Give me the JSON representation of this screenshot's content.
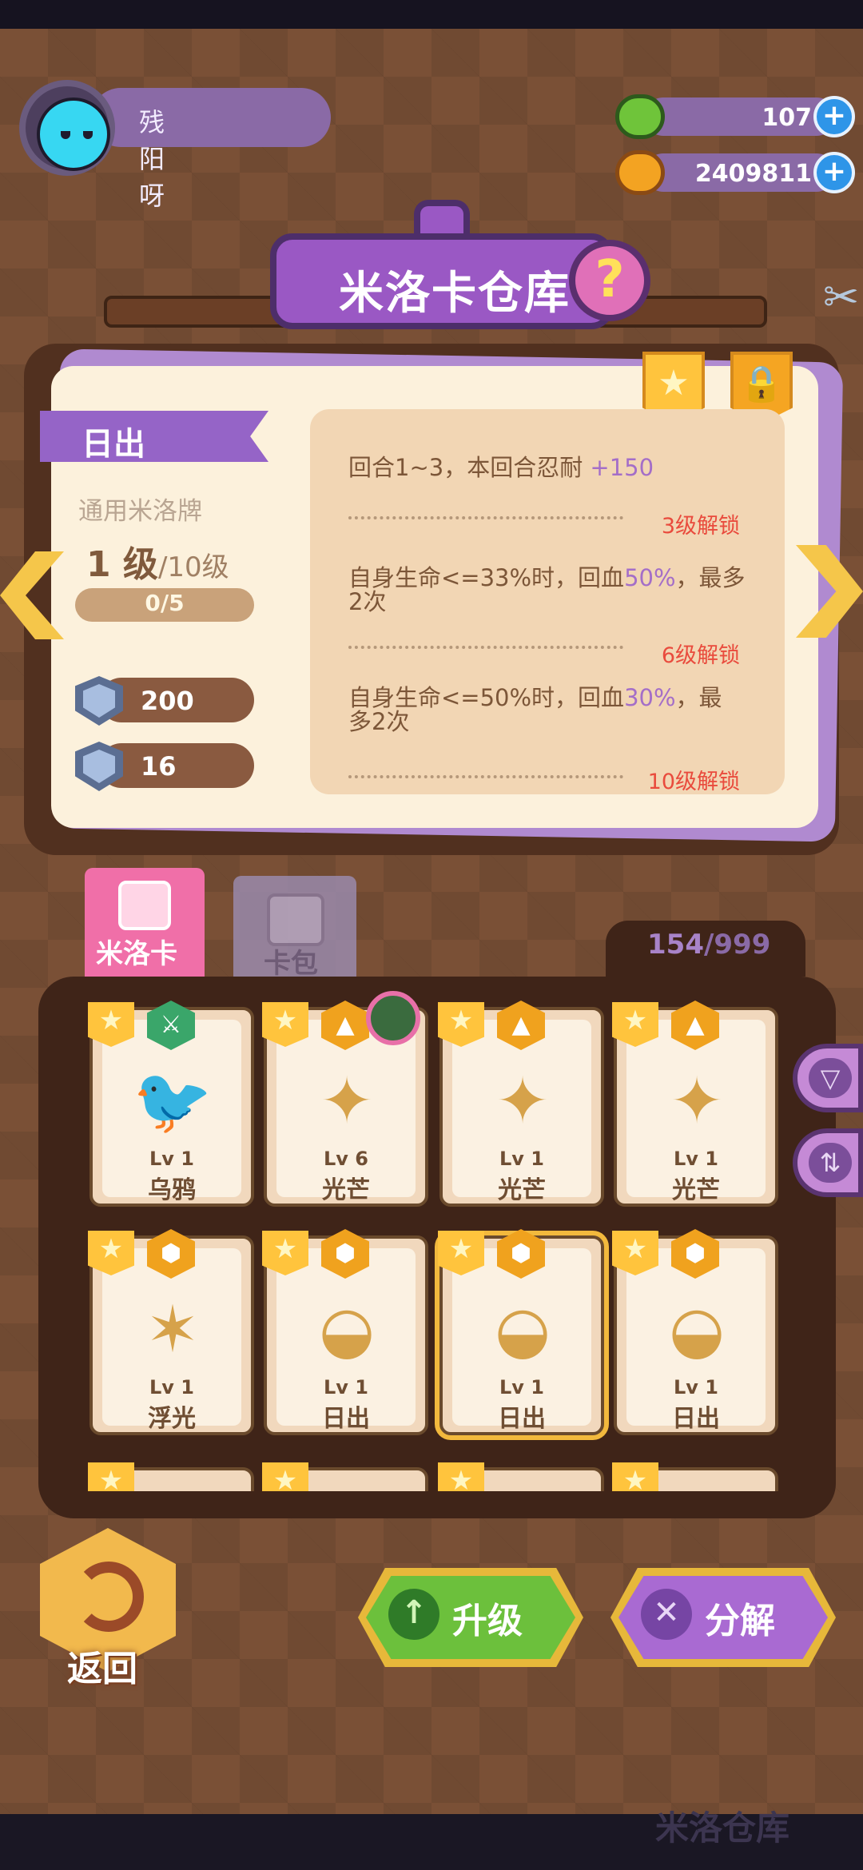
{
  "header": {
    "username": "残阳呀",
    "currencies": [
      {
        "icon": "green-gem-icon",
        "value": "107"
      },
      {
        "icon": "gold-planet-coin-icon",
        "value": "2409811"
      }
    ]
  },
  "title": "米洛卡仓库",
  "help_symbol": "?",
  "detail": {
    "name": "日出",
    "type": "通用米洛牌",
    "level_current": "1 级",
    "level_max": "/10级",
    "exp": "0/5",
    "exp_fraction": 0,
    "hp": "200",
    "defense": "16",
    "skills": [
      {
        "pre": "回合1~3，本回合忍耐 ",
        "hl": "+150",
        "post": "",
        "unlock": "3级解锁"
      },
      {
        "pre": "自身生命<=33%时，回血",
        "hl": "50%",
        "post": "，最多2次",
        "unlock": "6级解锁"
      },
      {
        "pre": "自身生命<=50%时，回血",
        "hl": "30%",
        "post": "，最多2次",
        "unlock": "10级解锁"
      }
    ]
  },
  "tabs": [
    {
      "label": "米洛卡",
      "active": true
    },
    {
      "label": "卡包",
      "active": false
    }
  ],
  "inventory": {
    "count": "154",
    "capacity": "/999"
  },
  "cards": [
    {
      "lv": "Lv 1",
      "name": "乌鸦",
      "badge": "green-sword-icon",
      "art": "crow-icon"
    },
    {
      "lv": "Lv 6",
      "name": "光芒",
      "badge": "up-triangle-icon",
      "art": "star-burst-icon"
    },
    {
      "lv": "Lv 1",
      "name": "光芒",
      "badge": "up-triangle-icon",
      "art": "star-burst-icon"
    },
    {
      "lv": "Lv 1",
      "name": "光芒",
      "badge": "up-triangle-icon",
      "art": "star-burst-icon"
    },
    {
      "lv": "Lv 1",
      "name": "浮光",
      "badge": "shield-badge-icon",
      "art": "floating-star-icon"
    },
    {
      "lv": "Lv 1",
      "name": "日出",
      "badge": "shield-badge-icon",
      "art": "sunrise-icon"
    },
    {
      "lv": "Lv 1",
      "name": "日出",
      "badge": "shield-badge-icon",
      "art": "sunrise-icon"
    },
    {
      "lv": "Lv 1",
      "name": "日出",
      "badge": "shield-badge-icon",
      "art": "sunrise-icon"
    }
  ],
  "buttons": {
    "back": "返回",
    "upgrade": "升级",
    "decompose": "分解"
  },
  "footer_bg_text": "米洛仓库",
  "colors": {
    "accent_purple": "#9a58c4",
    "unlock_red": "#e94b3d",
    "upgrade_green": "#6cc03c",
    "gold": "#f2b94d"
  }
}
